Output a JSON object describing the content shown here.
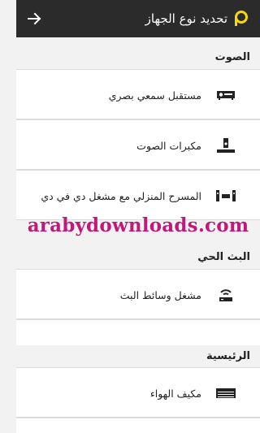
{
  "appbar": {
    "title": "تحديد نوع الجهاز",
    "back_icon": "arrow-left-icon",
    "logo_icon": "p-logo-icon",
    "logo_color": "#f5d90a"
  },
  "sections": [
    {
      "header": "الصوت",
      "items": [
        {
          "label": "مستقبل سمعي بصري",
          "icon": "av-receiver-icon"
        },
        {
          "label": "مكبرات الصوت",
          "icon": "soundbar-icon"
        },
        {
          "label": "المسرح المنزلي مع مشغل دي في دي",
          "icon": "home-theater-icon"
        }
      ]
    },
    {
      "header": "البث الحي",
      "items": [
        {
          "label": "مشغل وسائط البث",
          "icon": "streaming-player-icon"
        }
      ]
    },
    {
      "header": "الرئيسية",
      "items": [
        {
          "label": "مكيف الهواء",
          "icon": "air-conditioner-icon"
        }
      ]
    }
  ],
  "watermark": "arabydownloads.com",
  "colors": {
    "appbar_bg": "#2b2b2b",
    "watermark": "#c2187a",
    "page_bg": "#f2f2f2"
  }
}
